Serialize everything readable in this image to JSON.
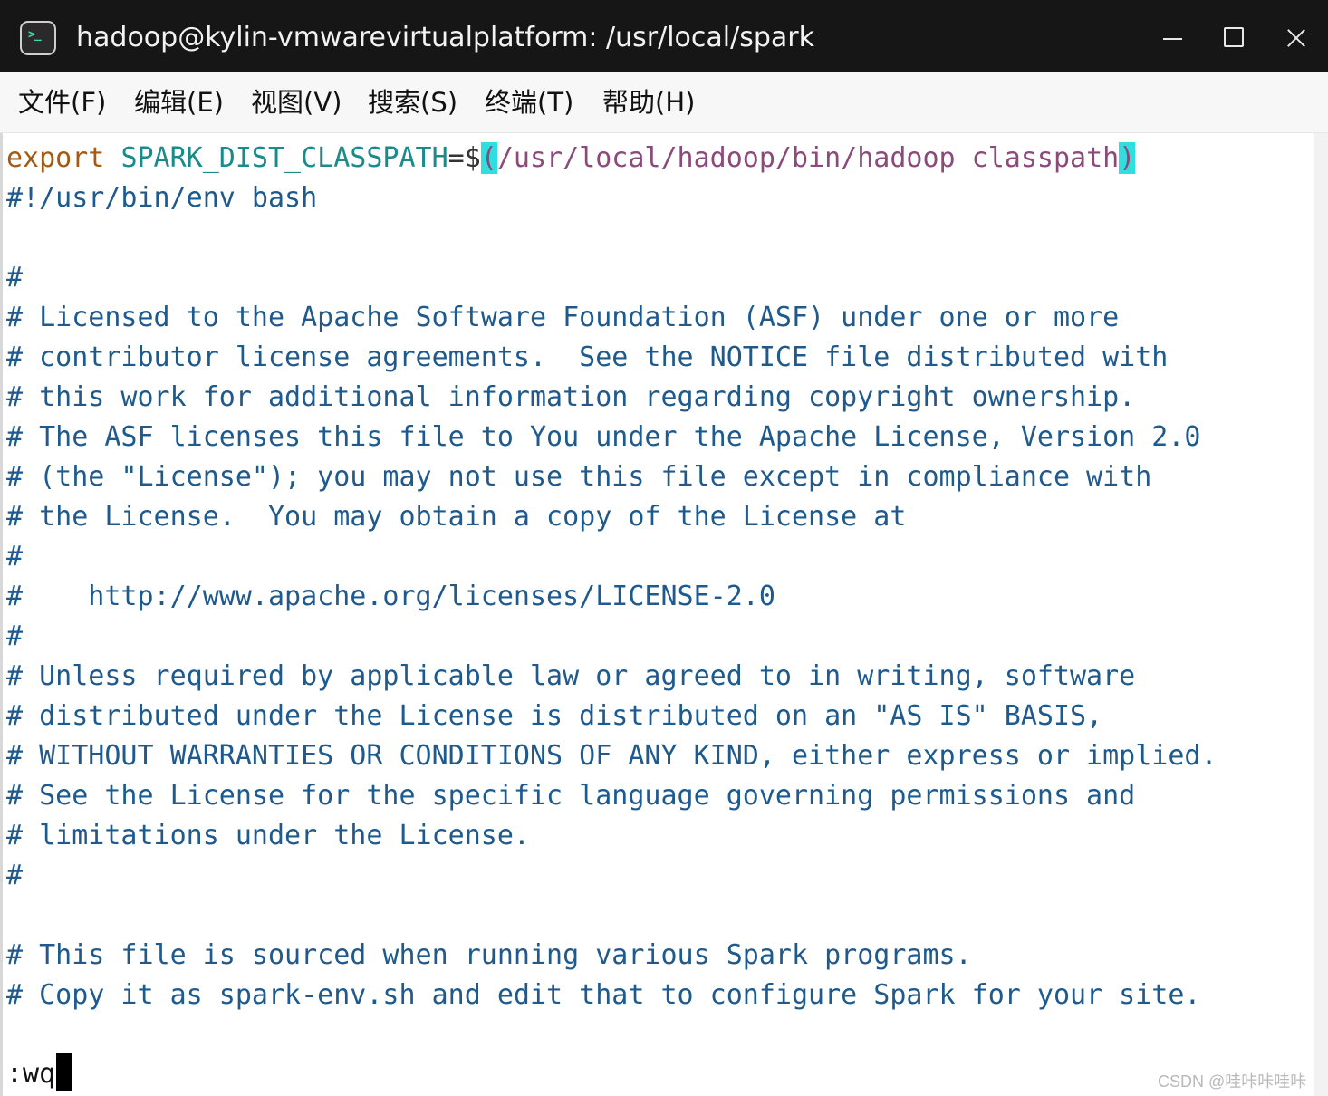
{
  "window": {
    "title": "hadoop@kylin-vmwarevirtualplatform: /usr/local/spark",
    "app_icon_glyph": ">_",
    "controls": [
      "minimize-icon",
      "maximize-icon",
      "close-icon"
    ]
  },
  "menu": [
    {
      "label": "文件(F)"
    },
    {
      "label": "编辑(E)"
    },
    {
      "label": "视图(V)"
    },
    {
      "label": "搜索(S)"
    },
    {
      "label": "终端(T)"
    },
    {
      "label": "帮助(H)"
    }
  ],
  "editor": {
    "first_line": {
      "keyword": "export",
      "variable": "SPARK_DIST_CLASSPATH",
      "operator": "=$",
      "paren_open": "(",
      "command": "/usr/local/hadoop/bin/hadoop classpath",
      "paren_close": ")"
    },
    "lines": [
      "#!/usr/bin/env bash",
      "",
      "#",
      "# Licensed to the Apache Software Foundation (ASF) under one or more",
      "# contributor license agreements.  See the NOTICE file distributed with",
      "# this work for additional information regarding copyright ownership.",
      "# The ASF licenses this file to You under the Apache License, Version 2.0",
      "# (the \"License\"); you may not use this file except in compliance with",
      "# the License.  You may obtain a copy of the License at",
      "#",
      "#    http://www.apache.org/licenses/LICENSE-2.0",
      "#",
      "# Unless required by applicable law or agreed to in writing, software",
      "# distributed under the License is distributed on an \"AS IS\" BASIS,",
      "# WITHOUT WARRANTIES OR CONDITIONS OF ANY KIND, either express or implied.",
      "# See the License for the specific language governing permissions and",
      "# limitations under the License.",
      "#",
      "",
      "# This file is sourced when running various Spark programs.",
      "# Copy it as spark-env.sh and edit that to configure Spark for your site."
    ],
    "command_line": ":wq"
  },
  "watermark": "CSDN @哇咔咔哇咔",
  "colors": {
    "titlebar": "#161616",
    "keyword": "#a45a14",
    "variable": "#1b8a8a",
    "string": "#8a4b7a",
    "comment": "#1f5a8e",
    "paren_highlight": "#2fdede"
  }
}
